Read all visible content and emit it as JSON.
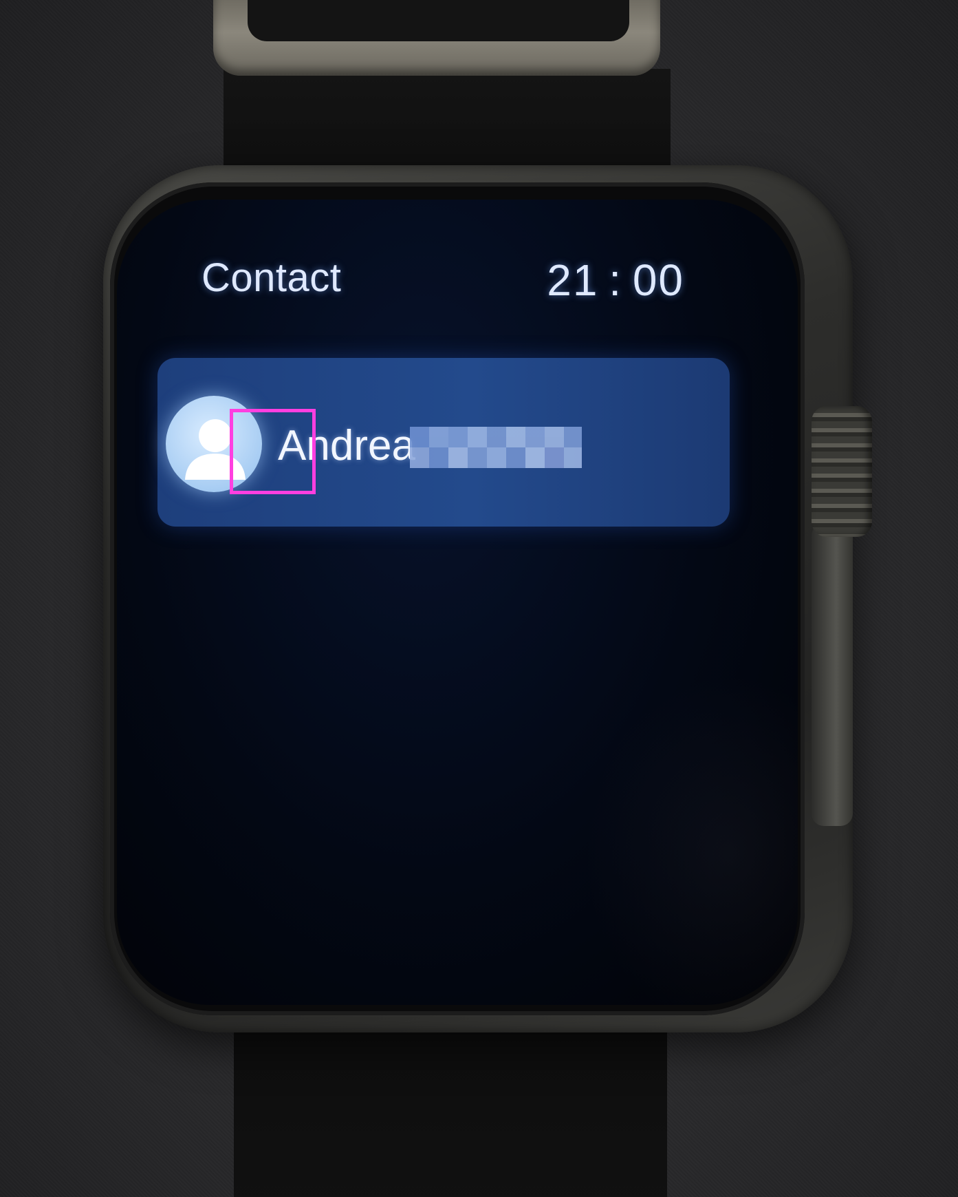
{
  "screen": {
    "title": "Contact",
    "time": "21 : 00"
  },
  "contacts": [
    {
      "name": "Andrea",
      "avatar_icon": "person-silhouette-icon",
      "surname_redacted": true
    }
  ],
  "colors": {
    "card_background": "#234a8c",
    "screen_text": "#dfe9ff",
    "highlight_box": "#ff3fe0"
  }
}
